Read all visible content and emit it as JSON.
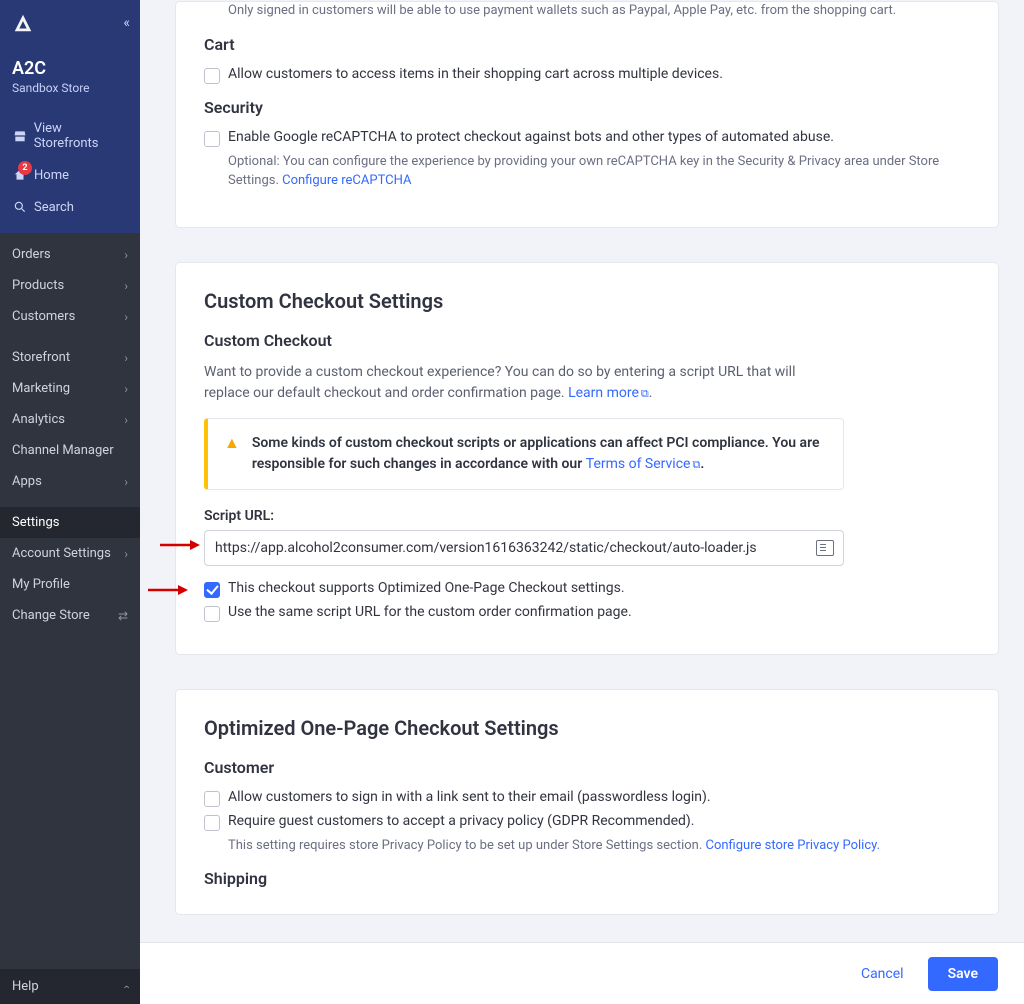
{
  "store": {
    "name": "A2C",
    "tag": "Sandbox Store"
  },
  "nav_blue": {
    "view_storefronts": "View Storefronts",
    "home": "Home",
    "home_badge": "2",
    "search": "Search"
  },
  "nav": {
    "orders": "Orders",
    "products": "Products",
    "customers": "Customers",
    "storefront": "Storefront",
    "marketing": "Marketing",
    "analytics": "Analytics",
    "channel_manager": "Channel Manager",
    "apps": "Apps",
    "settings": "Settings",
    "account_settings": "Account Settings",
    "my_profile": "My Profile",
    "change_store": "Change Store"
  },
  "help": "Help",
  "panel1": {
    "wallet_desc": "Only signed in customers will be able to use payment wallets such as Paypal, Apple Pay, etc. from the shopping cart.",
    "cart_title": "Cart",
    "cart_opt": "Allow customers to access items in their shopping cart across multiple devices.",
    "security_title": "Security",
    "security_opt": "Enable Google reCAPTCHA to protect checkout against bots and other types of automated abuse.",
    "security_desc": "Optional: You can configure the experience by providing your own reCAPTCHA key in the Security & Privacy area under Store Settings. ",
    "security_link": "Configure reCAPTCHA"
  },
  "panel2": {
    "title": "Custom Checkout Settings",
    "sub": "Custom Checkout",
    "desc": "Want to provide a custom checkout experience? You can do so by entering a script URL that will replace our default checkout and order confirmation page. ",
    "learn_more": "Learn more",
    "warn": "Some kinds of custom checkout scripts or applications can affect PCI compliance. You are responsible for such changes in accordance with our ",
    "tos": "Terms of Service",
    "script_label": "Script URL:",
    "script_value": "https://app.alcohol2consumer.com/version1616363242/static/checkout/auto-loader.js",
    "opt1": "This checkout supports Optimized One-Page Checkout settings.",
    "opt2": "Use the same script URL for the custom order confirmation page."
  },
  "panel3": {
    "title": "Optimized One-Page Checkout Settings",
    "customer_title": "Customer",
    "c_opt1": "Allow customers to sign in with a link sent to their email (passwordless login).",
    "c_opt2": "Require guest customers to accept a privacy policy (GDPR Recommended).",
    "c_desc": "This setting requires store Privacy Policy to be set up under Store Settings section. ",
    "c_link": "Configure store Privacy Policy.",
    "shipping_title": "Shipping"
  },
  "footer": {
    "cancel": "Cancel",
    "save": "Save"
  }
}
